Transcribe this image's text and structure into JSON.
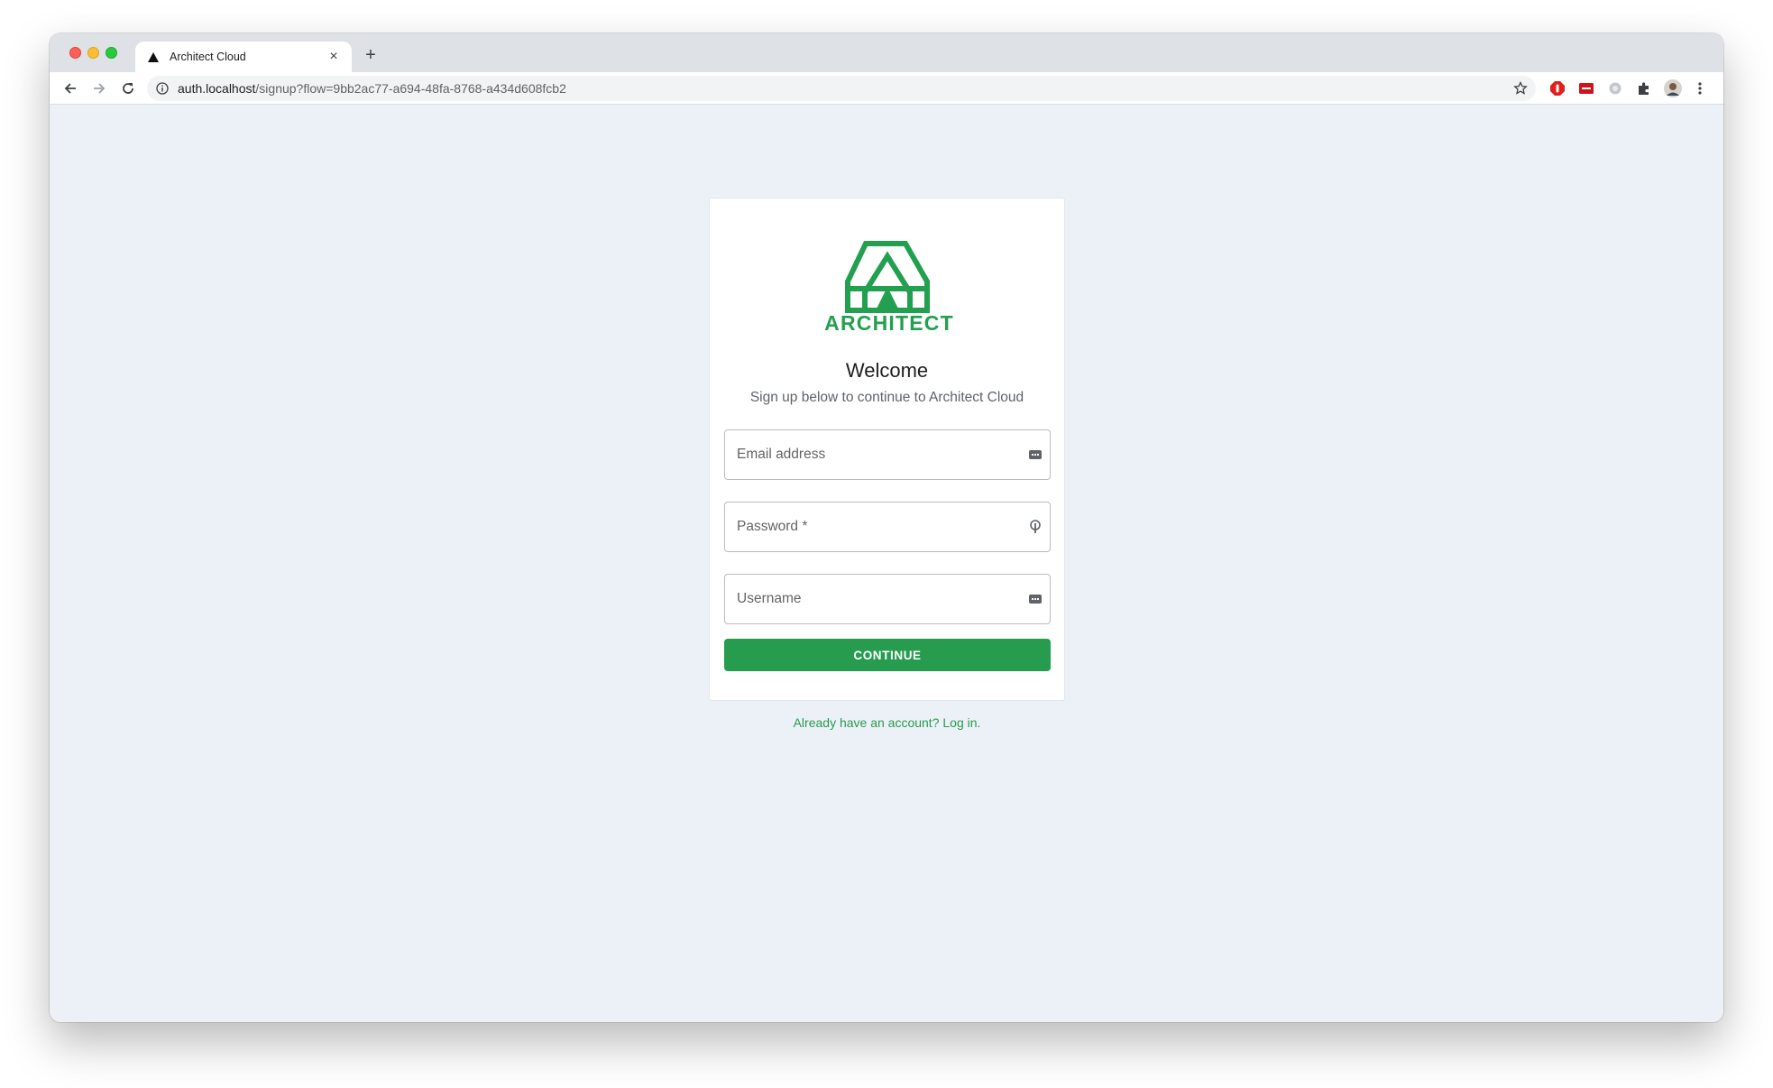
{
  "browser": {
    "tab": {
      "title": "Architect Cloud"
    },
    "omnibox": {
      "host": "auth.localhost",
      "path": "/signup?flow=9bb2ac77-a694-48fa-8768-a434d608fcb2"
    }
  },
  "signup": {
    "logo_text": "ARCHITECT",
    "welcome": "Welcome",
    "subtitle": "Sign up below to continue to Architect Cloud",
    "fields": {
      "email": {
        "placeholder": "Email address",
        "value": ""
      },
      "password": {
        "placeholder": "Password *",
        "value": ""
      },
      "username": {
        "placeholder": "Username",
        "value": ""
      }
    },
    "continue_label": "CONTINUE",
    "login_link": "Already have an account? Log in."
  },
  "colors": {
    "brand_green": "#279c4f",
    "page_background": "#ecf0f7"
  },
  "icons": {
    "tab_favicon": "architect-triangle-icon",
    "field_autofill": "keyboard-icon",
    "password_manager": "key-icon"
  }
}
